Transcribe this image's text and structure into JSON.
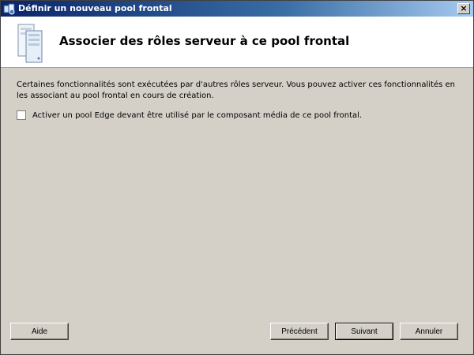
{
  "window": {
    "title": "Définir un nouveau pool frontal",
    "close_glyph": "×"
  },
  "header": {
    "title": "Associer des rôles serveur à ce pool frontal",
    "icon": "server-icon"
  },
  "main": {
    "description": "Certaines fonctionnalités sont exécutées par d'autres rôles serveur. Vous pouvez activer ces fonctionnalités en les associant au pool frontal en cours de création.",
    "checkbox": {
      "label": "Activer un pool Edge devant être utilisé par le composant média de ce pool frontal.",
      "checked": false
    }
  },
  "buttons": {
    "help": "Aide",
    "previous": "Précédent",
    "next": "Suivant",
    "cancel": "Annuler"
  },
  "colors": {
    "dialog_bg": "#d4d0c8",
    "titlebar": "#0a246a",
    "header_bg": "#ffffff"
  }
}
